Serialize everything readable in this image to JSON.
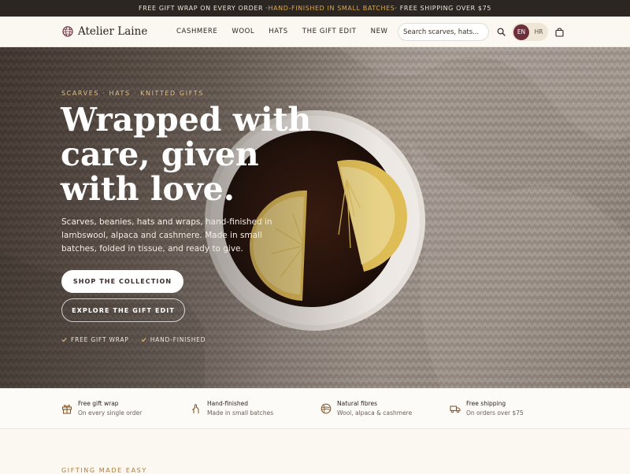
{
  "announcement": {
    "part1": "FREE GIFT WRAP ON EVERY ORDER · ",
    "highlight": "HAND-FINISHED IN SMALL BATCHES",
    "part2": " · FREE SHIPPING OVER $75"
  },
  "header": {
    "logo_text": "Atelier Laine",
    "nav": [
      "CASHMERE",
      "WOOL",
      "HATS",
      "THE GIFT EDIT",
      "NEW"
    ],
    "search_placeholder": "Search scarves, hats...",
    "lang_active": "EN",
    "lang_other": "HR"
  },
  "hero": {
    "eyebrow": "SCARVES · HATS · KNITTED GIFTS",
    "headline": "Wrapped with care, given with love.",
    "subtext": "Scarves, beanies, hats and wraps, hand-finished in lambswool, alpaca and cashmere. Made in small batches, folded in tissue, and ready to give.",
    "primary_cta": "SHOP THE COLLECTION",
    "secondary_cta": "EXPLORE THE GIFT EDIT",
    "checks": [
      "FREE GIFT WRAP",
      "HAND-FINISHED"
    ]
  },
  "features": [
    {
      "title": "Free gift wrap",
      "subtitle": "On every single order",
      "icon": "gift-icon"
    },
    {
      "title": "Hand-finished",
      "subtitle": "Made in small batches",
      "icon": "hand-icon"
    },
    {
      "title": "Natural fibres",
      "subtitle": "Wool, alpaca & cashmere",
      "icon": "yarn-icon"
    },
    {
      "title": "Free shipping",
      "subtitle": "On orders over $75",
      "icon": "truck-icon"
    }
  ],
  "section_eyebrow": "GIFTING MADE EASY",
  "colors": {
    "accent": "#6e2f3c",
    "gold": "#e0a84a",
    "dark": "#2b2622"
  }
}
